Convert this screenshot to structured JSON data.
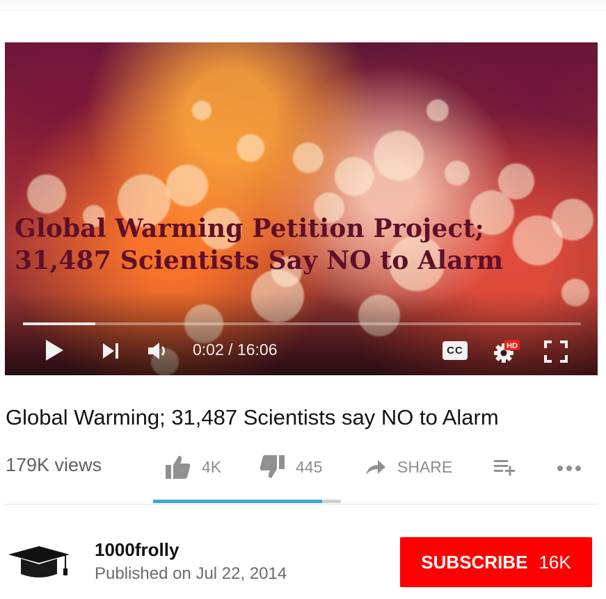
{
  "player": {
    "overlay_line1": "Global Warming Petition Project;",
    "overlay_line2": "31,487 Scientists Say NO to Alarm",
    "current_time": "0:02",
    "duration": "16:06",
    "time_display": "0:02 / 16:06",
    "progress_fraction": 0.13,
    "cc_label": "CC",
    "hd_badge": "HD",
    "icons": [
      "play-icon",
      "next-icon",
      "volume-icon",
      "cc-icon",
      "settings-icon",
      "fullscreen-icon"
    ]
  },
  "video": {
    "title": "Global Warming; 31,487 Scientists say NO to Alarm",
    "views": "179K views",
    "likes": "4K",
    "dislikes": "445",
    "share_label": "SHARE",
    "like_ratio": 0.9
  },
  "channel": {
    "name": "1000frolly",
    "published": "Published on Jul 22, 2014",
    "subscribe_label": "SUBSCRIBE",
    "subscriber_count": "16K"
  },
  "colors": {
    "subscribe": "#ff0000",
    "sentiment_bar": "#3ea6d8",
    "overlay_text": "#5e0f2a"
  }
}
